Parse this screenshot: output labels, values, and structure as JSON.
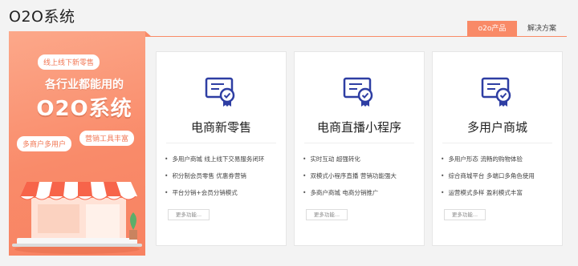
{
  "page": {
    "title": "O2O系统"
  },
  "tabs": [
    {
      "label": "o2o产品",
      "active": true
    },
    {
      "label": "解决方案",
      "active": false
    }
  ],
  "promo": {
    "tag_top": "线上线下新零售",
    "heading": "各行业都能用的",
    "big_title": "O2O系统",
    "tag_left": "多商户多用户",
    "tag_right": "营销工具丰富"
  },
  "cards": [
    {
      "title": "电商新零售",
      "icon": "certificate-icon",
      "features": [
        "多用户商城  线上线下交易服务闭环",
        "积分制会员零售  优惠券营销",
        "平台分销+会员分销模式"
      ],
      "more_label": "更多功能..."
    },
    {
      "title": "电商直播小程序",
      "icon": "certificate-icon",
      "features": [
        "实时互动  超强转化",
        "双模式小程序直播  营销功能强大",
        "多商户商城  电商分销推广"
      ],
      "more_label": "更多功能..."
    },
    {
      "title": "多用户商城",
      "icon": "certificate-icon",
      "features": [
        "多用户形态  流畅的购物体验",
        "综合商城平台  多端口多角色使用",
        "运营模式多样  盈利模式丰富"
      ],
      "more_label": "更多功能..."
    }
  ],
  "colors": {
    "accent": "#f98a67",
    "icon_blue": "#2e3ea3"
  }
}
